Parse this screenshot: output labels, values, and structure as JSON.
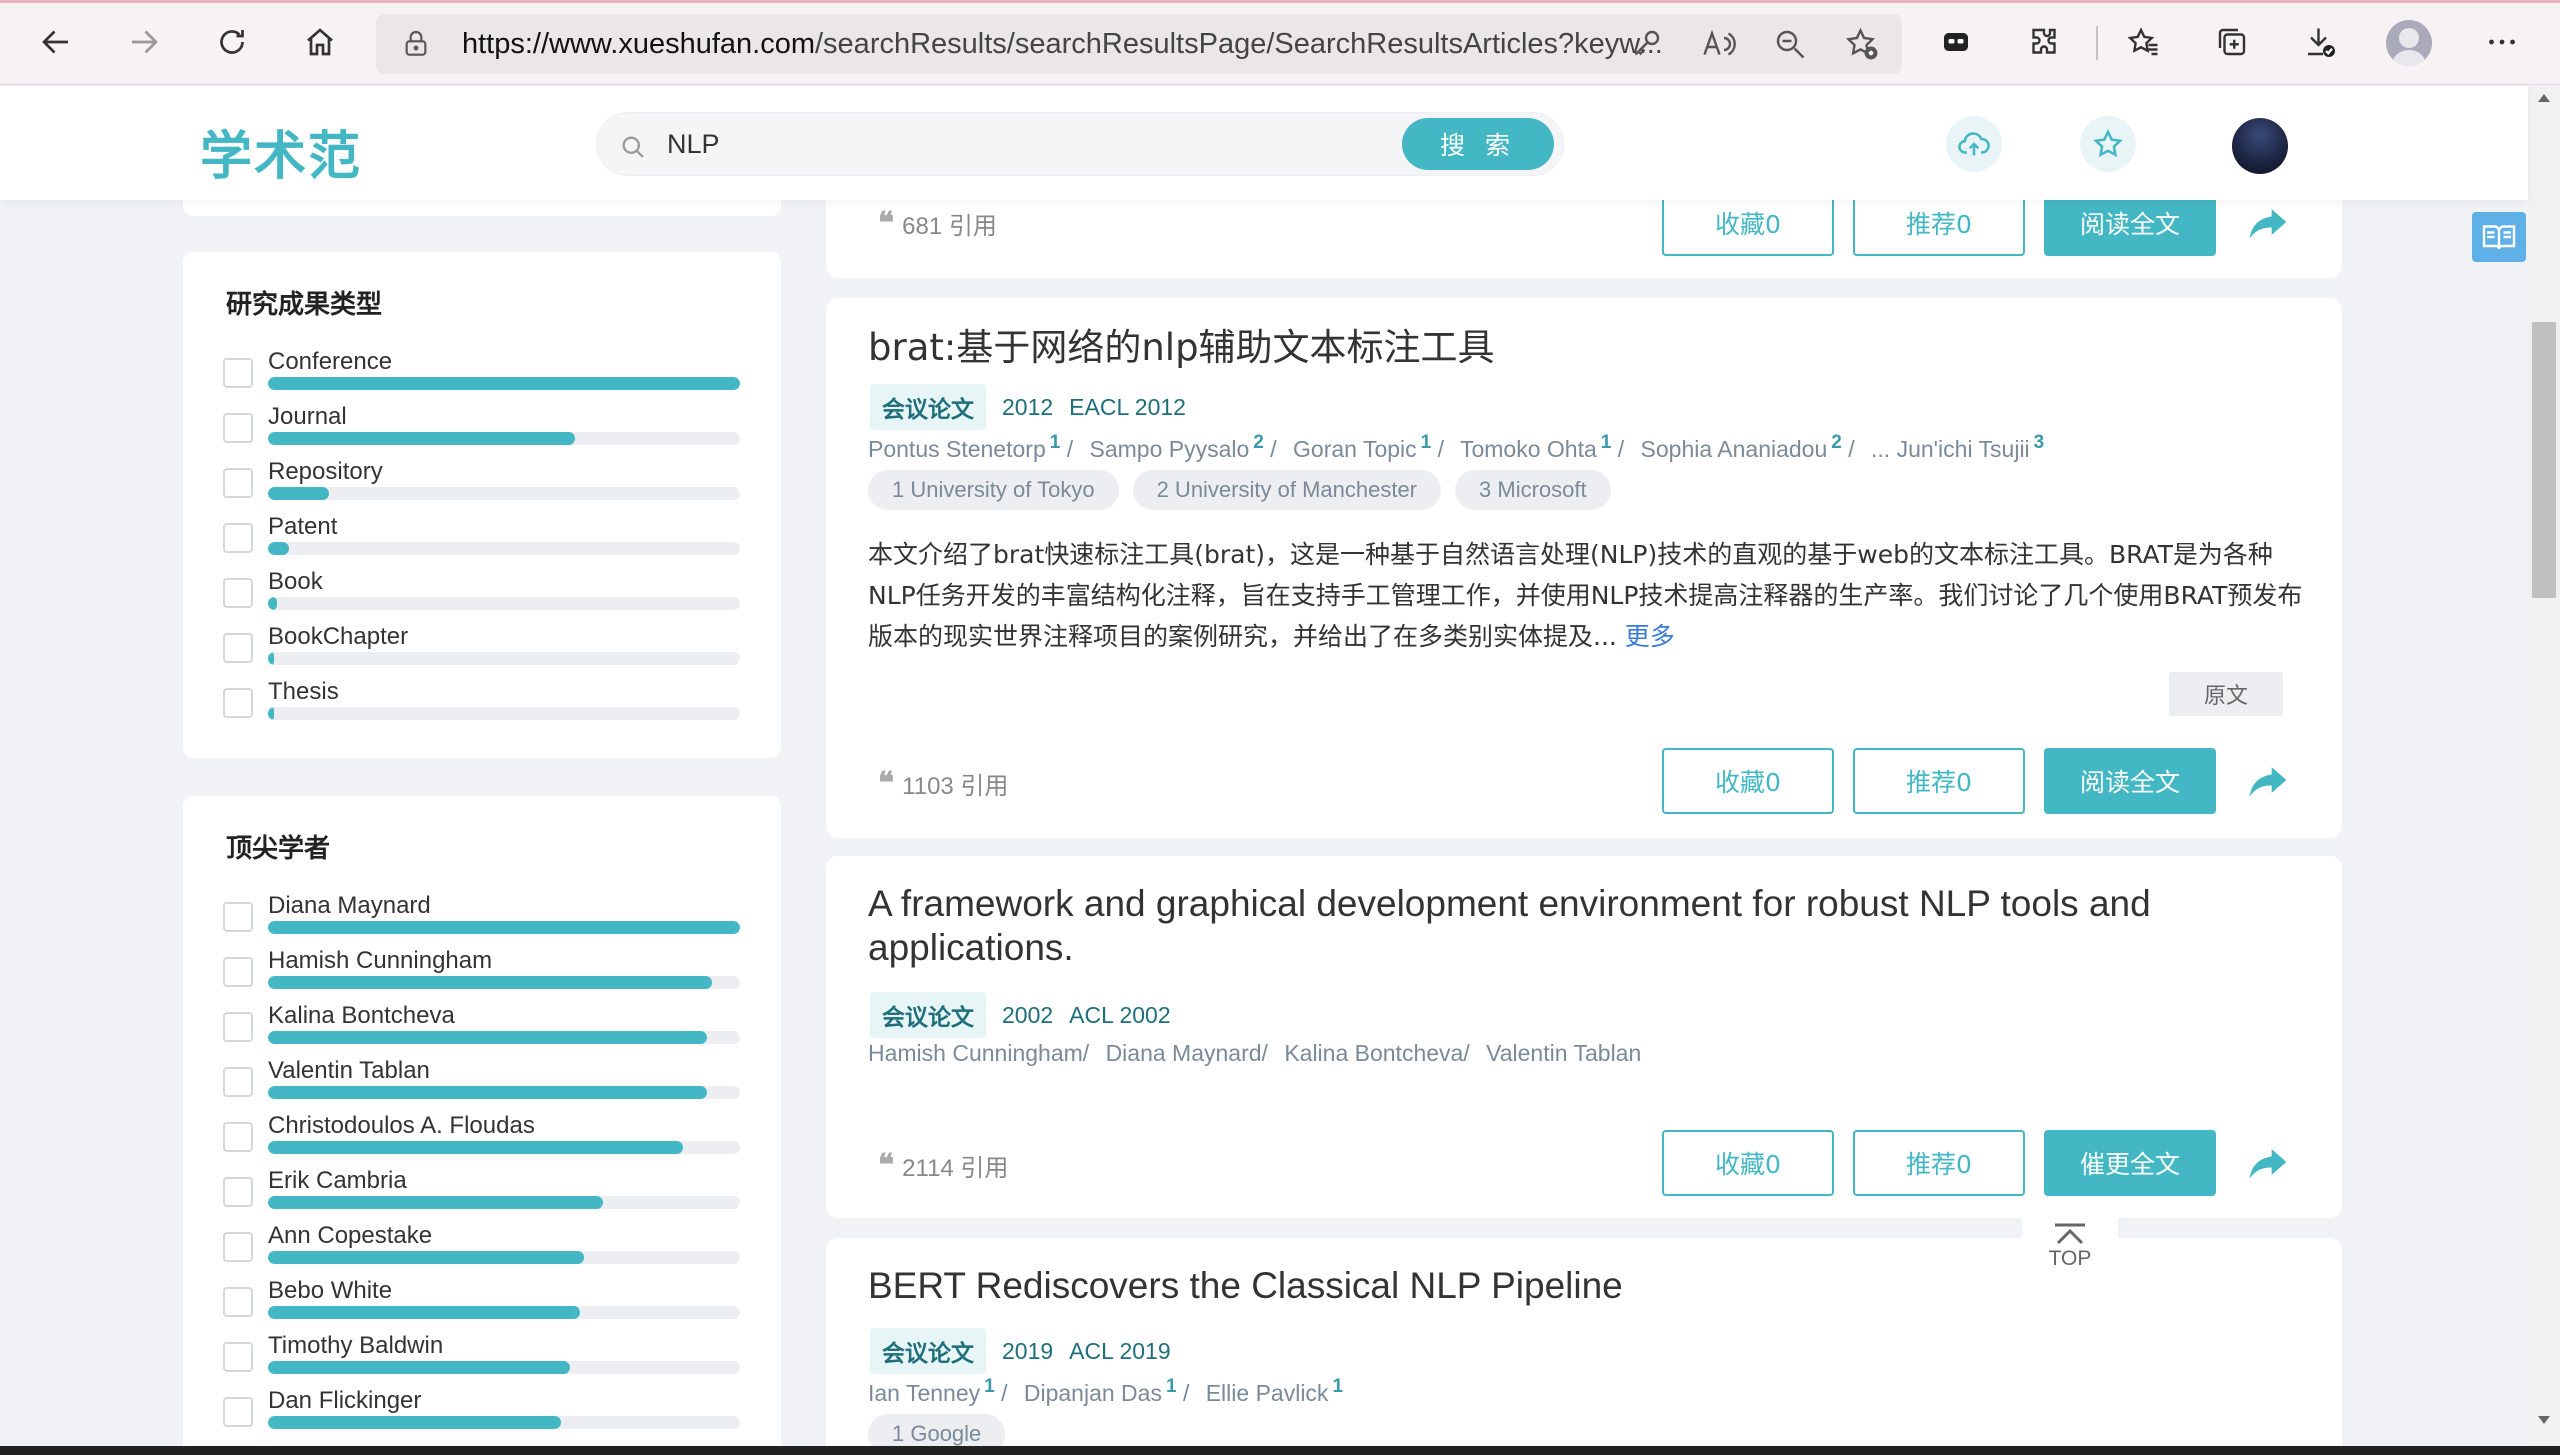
{
  "browser": {
    "url_domain": "https://www.xueshufan.com",
    "url_path": "/searchResults/searchResultsPage/SearchResultsArticles?keyw..."
  },
  "header": {
    "logo": "学术范",
    "search_value": "NLP",
    "search_button": "搜 索"
  },
  "sidebar": {
    "result_type": {
      "title": "研究成果类型",
      "items": [
        {
          "label": "Conference",
          "fill": 1.0
        },
        {
          "label": "Journal",
          "fill": 0.65
        },
        {
          "label": "Repository",
          "fill": 0.13
        },
        {
          "label": "Patent",
          "fill": 0.045
        },
        {
          "label": "Book",
          "fill": 0.02
        },
        {
          "label": "BookChapter",
          "fill": 0.008
        },
        {
          "label": "Thesis",
          "fill": 0.004
        }
      ]
    },
    "top_scholars": {
      "title": "顶尖学者",
      "items": [
        {
          "label": "Diana Maynard",
          "fill": 1.0
        },
        {
          "label": "Hamish Cunningham",
          "fill": 0.94
        },
        {
          "label": "Kalina Bontcheva",
          "fill": 0.93
        },
        {
          "label": "Valentin Tablan",
          "fill": 0.93
        },
        {
          "label": "Christodoulos A. Floudas",
          "fill": 0.88
        },
        {
          "label": "Erik Cambria",
          "fill": 0.71
        },
        {
          "label": "Ann Copestake",
          "fill": 0.67
        },
        {
          "label": "Bebo White",
          "fill": 0.66
        },
        {
          "label": "Timothy Baldwin",
          "fill": 0.64
        },
        {
          "label": "Dan Flickinger",
          "fill": 0.62
        }
      ]
    }
  },
  "results": {
    "partial_top": {
      "citations": "681 引用",
      "collect": "收藏0",
      "recommend": "推荐0",
      "read": "阅读全文"
    },
    "r1": {
      "title": "brat:基于网络的nlp辅助文本标注工具",
      "type": "会议论文",
      "year": "2012",
      "venue": "EACL 2012",
      "authors": [
        {
          "name": "Pontus Stenetorp",
          "aff": "1",
          "sep": "/"
        },
        {
          "name": "Sampo Pyysalo",
          "aff": "2",
          "sep": "/"
        },
        {
          "name": "Goran Topic",
          "aff": "1",
          "sep": "/"
        },
        {
          "name": "Tomoko Ohta",
          "aff": "1",
          "sep": "/"
        },
        {
          "name": "Sophia Ananiadou",
          "aff": "2",
          "sep": "/"
        },
        {
          "name": "... Jun'ichi Tsujii",
          "aff": "3",
          "sep": ""
        }
      ],
      "affiliations": [
        "1 University of Tokyo",
        "2 University of Manchester",
        "3 Microsoft"
      ],
      "abstract": "本文介绍了brat快速标注工具(brat)，这是一种基于自然语言处理(NLP)技术的直观的基于web的文本标注工具。BRAT是为各种NLP任务开发的丰富结构化注释，旨在支持手工管理工作，并使用NLP技术提高注释器的生产率。我们讨论了几个使用BRAT预发布版本的现实世界注释项目的案例研究，并给出了在多类别实体提及...",
      "more": "更多",
      "original": "原文",
      "citations": "1103 引用",
      "collect": "收藏0",
      "recommend": "推荐0",
      "read": "阅读全文"
    },
    "r2": {
      "title_line1": "A framework and graphical development environment for robust NLP tools and",
      "title_line2": "applications.",
      "type": "会议论文",
      "year": "2002",
      "venue": "ACL 2002",
      "authors": [
        {
          "name": "Hamish Cunningham",
          "sep": "/"
        },
        {
          "name": "Diana Maynard",
          "sep": "/"
        },
        {
          "name": "Kalina Bontcheva",
          "sep": "/"
        },
        {
          "name": "Valentin Tablan",
          "sep": ""
        }
      ],
      "citations": "2114 引用",
      "collect": "收藏0",
      "recommend": "推荐0",
      "read": "催更全文"
    },
    "r3": {
      "title": "BERT Rediscovers the Classical NLP Pipeline",
      "type": "会议论文",
      "year": "2019",
      "venue": "ACL 2019",
      "authors": [
        {
          "name": "Ian Tenney",
          "aff": "1",
          "sep": "/"
        },
        {
          "name": "Dipanjan Das",
          "aff": "1",
          "sep": "/"
        },
        {
          "name": "Ellie Pavlick",
          "aff": "1",
          "sep": ""
        }
      ],
      "affiliations": [
        "1 Google"
      ]
    }
  },
  "float": {
    "top_label": "TOP"
  },
  "colors": {
    "accent": "#43b7c4",
    "tag_text": "#1f6f7b",
    "link": "#3a7bd5"
  },
  "icons": [
    "back-icon",
    "forward-icon",
    "refresh-icon",
    "home-icon",
    "lock-icon",
    "key-icon",
    "read-aloud-icon",
    "zoom-out-icon",
    "add-favorite-icon",
    "extension-icon",
    "puzzle-icon",
    "favorites-icon",
    "collections-icon",
    "downloads-icon",
    "profile-icon",
    "more-icon",
    "search-icon",
    "cloud-upload-icon",
    "star-icon",
    "quote-icon",
    "share-icon",
    "reader-icon",
    "chevron-up-icon"
  ]
}
